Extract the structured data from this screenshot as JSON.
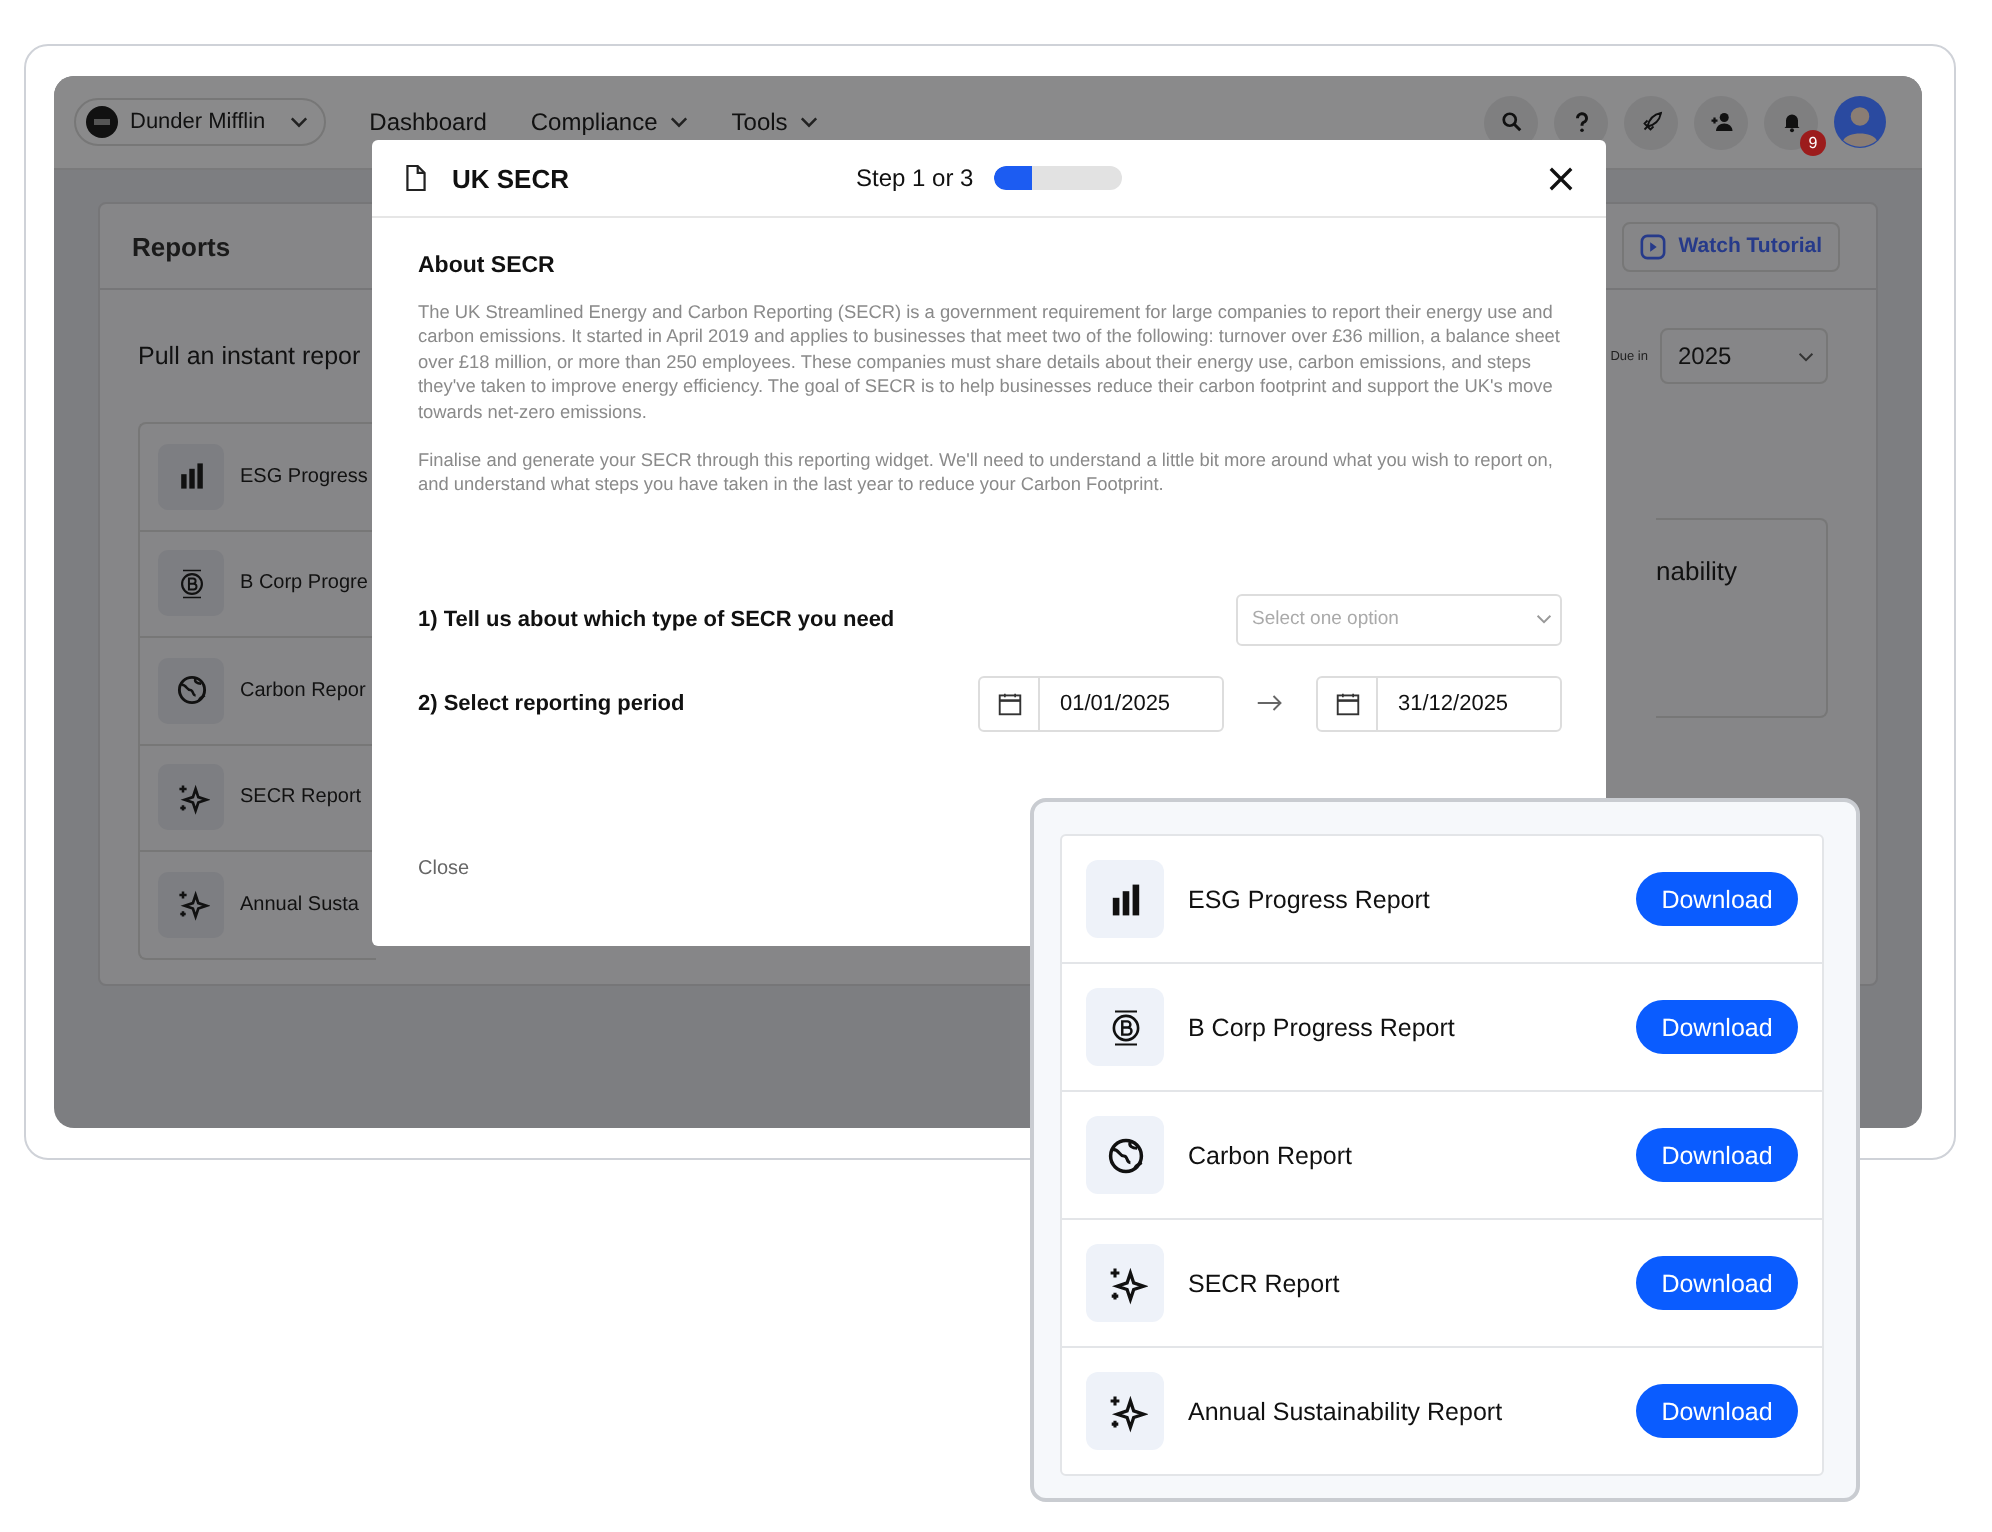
{
  "app": {
    "org": "Dunder Mifflin",
    "nav": [
      {
        "label": "Dashboard",
        "dropdown": false
      },
      {
        "label": "Compliance",
        "dropdown": true
      },
      {
        "label": "Tools",
        "dropdown": true
      }
    ],
    "notification_count": "9"
  },
  "reports_panel": {
    "title": "Reports",
    "tutorial_button": "Watch Tutorial",
    "prompt": "Pull an instant repor",
    "due_label": "Due in",
    "year": "2025",
    "items": [
      {
        "name": "ESG Progress",
        "kind": "bars"
      },
      {
        "name": "B Corp Progre",
        "kind": "bcorp"
      },
      {
        "name": "Carbon Repor",
        "kind": "globe"
      },
      {
        "name": "SECR Report",
        "kind": "sparkle"
      },
      {
        "name": "Annual Susta",
        "kind": "sparkle"
      }
    ],
    "side_card_text": "nability"
  },
  "modal": {
    "title": "UK SECR",
    "step": "Step 1 or 3",
    "progress": {
      "level": 0.3
    },
    "heading": "About SECR",
    "paragraphs": [
      "The UK Streamlined Energy and Carbon Reporting (SECR) is a government requirement for large companies to report their energy use and carbon emissions. It started in April 2019 and applies to businesses that meet two of the following: turnover over £36 million, a balance sheet over £18 million, or more than 250 employees. These companies must share details about their energy use, carbon emissions, and steps they've taken to improve energy efficiency. The goal of SECR is to help businesses reduce their carbon footprint and support the UK's move towards net-zero emissions.",
      "Finalise and generate your SECR through this reporting widget. We'll need to understand a little bit more around what you wish to report on, and understand what steps you have taken in the last year to reduce your Carbon Footprint."
    ],
    "type_question": {
      "label": "1) Tell us about which type of SECR you need",
      "placeholder": "Select one option"
    },
    "period_question": {
      "label": "2) Select reporting period",
      "start": "01/01/2025",
      "end": "31/12/2025"
    },
    "close": "Close"
  },
  "download_card": {
    "items": [
      {
        "name": "ESG Progress Report",
        "kind": "bars",
        "button": "Download"
      },
      {
        "name": "B Corp Progress Report",
        "kind": "bcorp",
        "button": "Download"
      },
      {
        "name": "Carbon Report",
        "kind": "globe",
        "button": "Download"
      },
      {
        "name": "SECR Report",
        "kind": "sparkle",
        "button": "Download"
      },
      {
        "name": "Annual Sustainability Report",
        "kind": "sparkle",
        "button": "Download"
      }
    ]
  }
}
